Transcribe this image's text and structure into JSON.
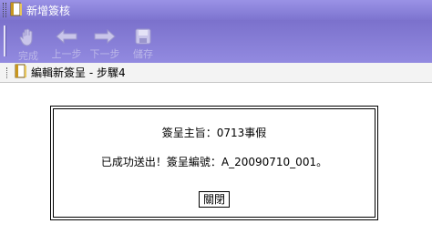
{
  "window": {
    "title": "新增簽核",
    "icon": "book-icon"
  },
  "toolbar": {
    "buttons": [
      {
        "label": "完成",
        "icon": "hand-icon"
      },
      {
        "label": "上一步",
        "icon": "arrow-left-icon"
      },
      {
        "label": "下一步",
        "icon": "arrow-right-icon"
      },
      {
        "label": "儲存",
        "icon": "save-icon"
      }
    ]
  },
  "subheader": {
    "title": "編輯新簽呈 - 步驟4",
    "icon": "book-icon"
  },
  "dialog": {
    "subject": "簽呈主旨：0713事假",
    "message": "已成功送出！簽呈編號：A_20090710_001。",
    "close_label": "關閉"
  },
  "colors": {
    "titlebar": "#8a82d8",
    "toolbar": "#867ed6",
    "disabled_label": "#bcb7e8"
  }
}
